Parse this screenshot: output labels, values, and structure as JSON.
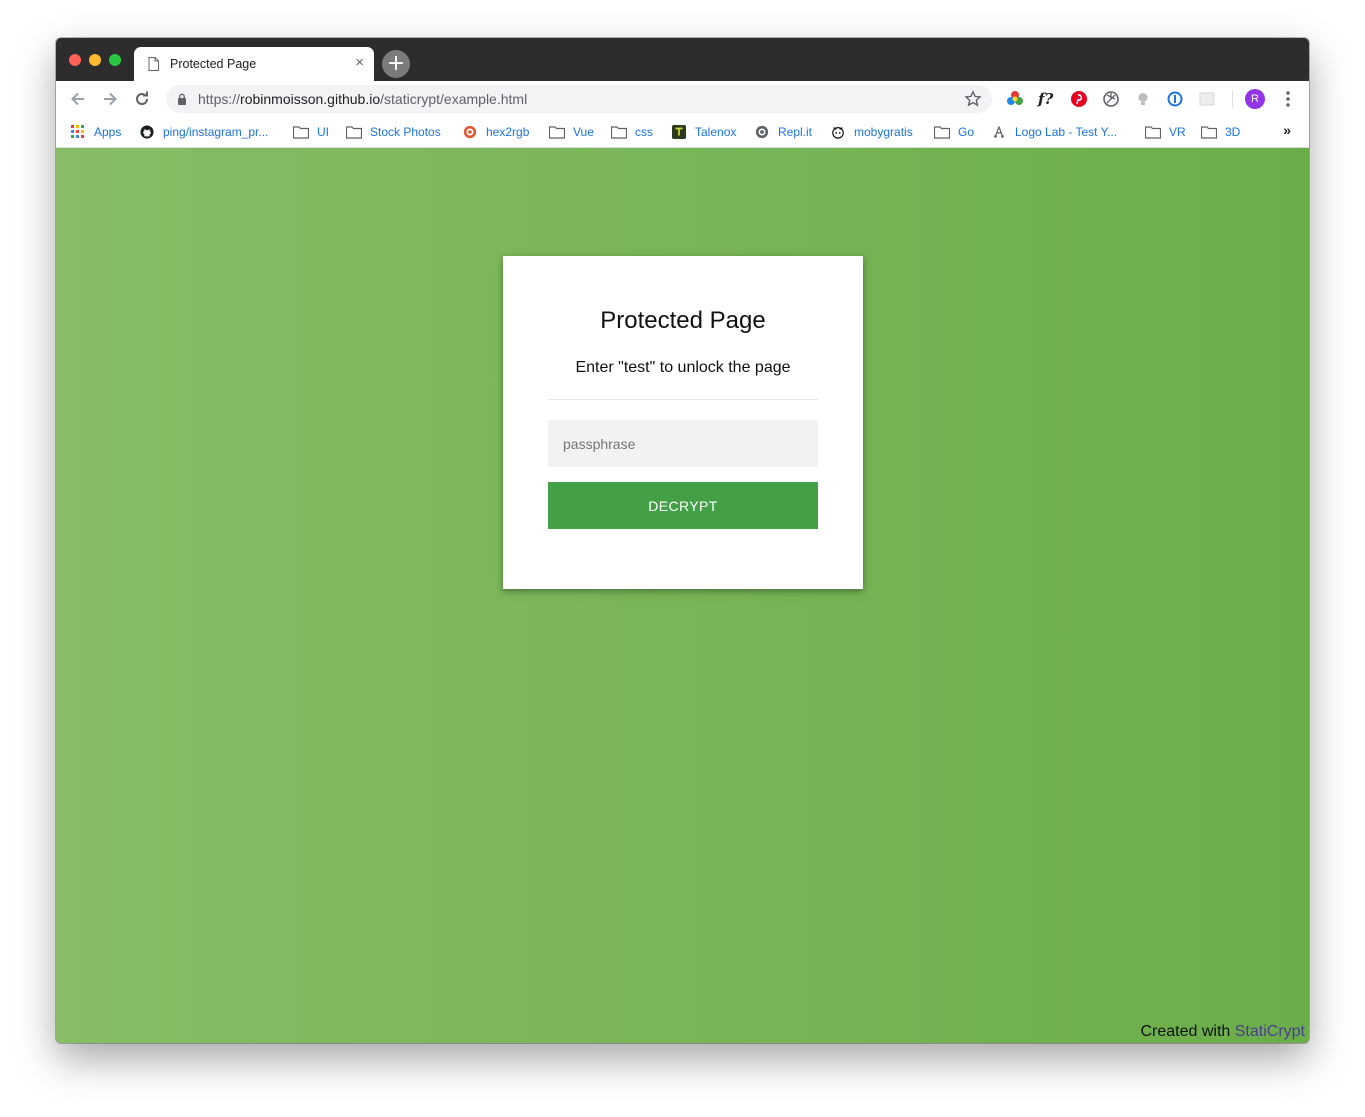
{
  "browser": {
    "tab_title": "Protected Page",
    "tab_close": "×",
    "new_tab": "+",
    "url_scheme": "https://",
    "url_host": "robinmoisson.github.io",
    "url_path": "/staticrypt/example.html",
    "avatar_letter": "R",
    "bookmarks_overflow": "»",
    "bookmarks": [
      {
        "label": "Apps",
        "icon": "apps-grid-icon"
      },
      {
        "label": "ping/instagram_pr...",
        "icon": "github-icon"
      },
      {
        "label": "UI",
        "icon": "folder-icon"
      },
      {
        "label": "Stock Photos",
        "icon": "folder-icon"
      },
      {
        "label": "hex2rgb",
        "icon": "hex2rgb-icon"
      },
      {
        "label": "Vue",
        "icon": "folder-icon"
      },
      {
        "label": "css",
        "icon": "folder-icon"
      },
      {
        "label": "Talenox",
        "icon": "talenox-icon"
      },
      {
        "label": "Repl.it",
        "icon": "replit-icon"
      },
      {
        "label": "mobygratis",
        "icon": "mobygratis-icon"
      },
      {
        "label": "Go",
        "icon": "folder-icon"
      },
      {
        "label": "Logo Lab - Test Y...",
        "icon": "logolab-icon"
      },
      {
        "label": "VR",
        "icon": "folder-icon"
      },
      {
        "label": "3D",
        "icon": "folder-icon"
      }
    ]
  },
  "page": {
    "title": "Protected Page",
    "instructions": "Enter \"test\" to unlock the page",
    "passphrase_placeholder": "passphrase",
    "passphrase_value": "",
    "decrypt_label": "DECRYPT",
    "footer_prefix": "Created with ",
    "footer_link": "StatiCrypt",
    "background_color_left": "#86bd65",
    "background_color_right": "#6aae49",
    "button_color": "#43a047"
  }
}
